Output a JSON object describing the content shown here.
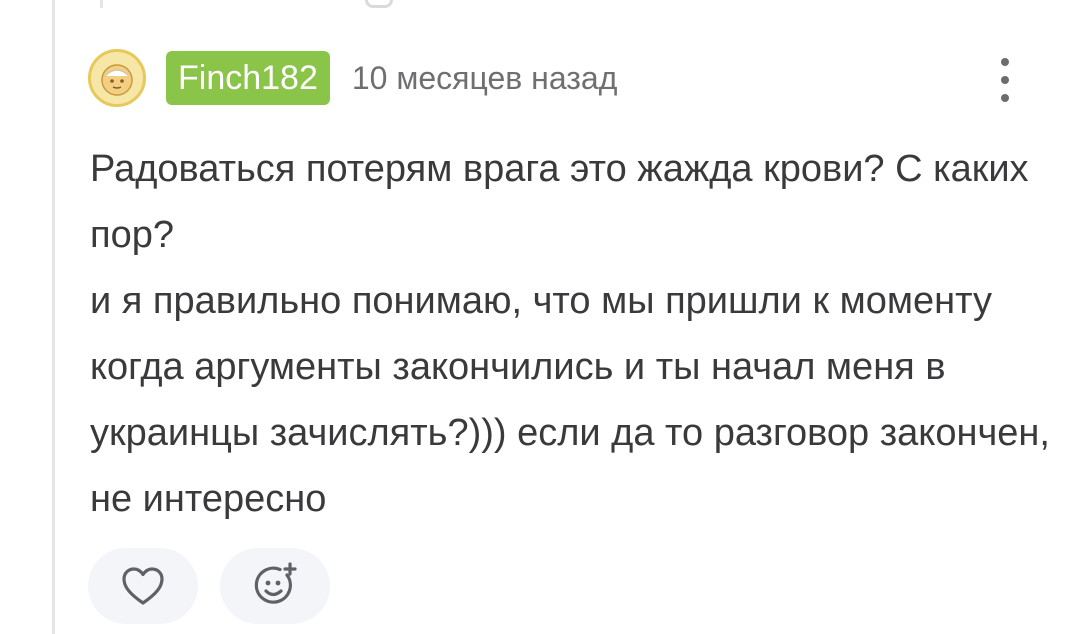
{
  "comment": {
    "username": "Finch182",
    "timestamp": "10 месяцев назад",
    "paragraphs": [
      "Радоваться потерям врага это жажда крови? С каких пор?",
      "и я правильно понимаю, что мы пришли к моменту когда аргументы закончились и ты начал меня в украинцы зачислять?))) если да то разговор закончен, не интересно"
    ],
    "icons": {
      "avatar": "avatar-icon",
      "more": "more-vertical-icon",
      "like": "heart-icon",
      "reaction": "add-reaction-icon"
    }
  },
  "colors": {
    "username_badge": "#8ac54a",
    "text": "#3a3a3d",
    "timestamp": "#6f6f73",
    "button_bg": "#f3f5f9"
  }
}
